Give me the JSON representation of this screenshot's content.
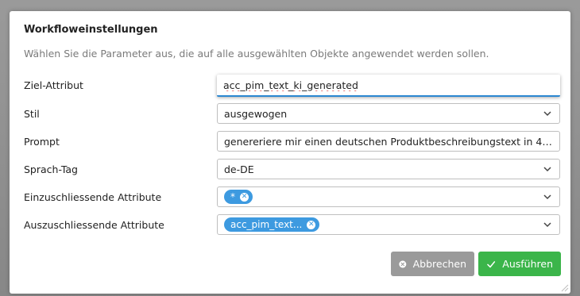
{
  "dialog": {
    "title": "Workfloweinstellungen",
    "description": "Wählen Sie die Parameter aus, die auf alle ausgewählten Objekte angewendet werden sollen."
  },
  "fields": {
    "target_attribute": {
      "label": "Ziel-Attribut",
      "value": "acc_pim_text_ki_generated"
    },
    "style": {
      "label": "Stil",
      "value": "ausgewogen"
    },
    "prompt": {
      "label": "Prompt",
      "value": "genereriere mir einen deutschen Produktbeschreibungstext in 4 Sä..."
    },
    "language_tag": {
      "label": "Sprach-Tag",
      "value": "de-DE"
    },
    "include_attributes": {
      "label": "Einzuschliessende Attribute",
      "tags": [
        "*"
      ]
    },
    "exclude_attributes": {
      "label": "Auszuschliessende Attribute",
      "tags": [
        "acc_pim_text..."
      ]
    }
  },
  "buttons": {
    "cancel": "Abbrechen",
    "run": "Ausführen"
  },
  "colors": {
    "tag": "#3d9ae0",
    "run_button": "#3bb54a",
    "cancel_button": "#9a9a9a",
    "focus_underline": "#2b87d1"
  },
  "icons": {
    "dropdown": "chevron-down-icon",
    "tag_remove": "close-icon",
    "cancel": "close-circle-icon",
    "run": "check-icon"
  }
}
